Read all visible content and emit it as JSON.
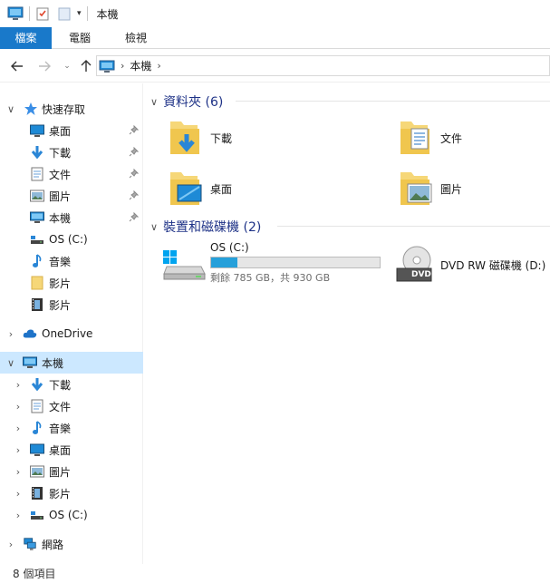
{
  "window": {
    "title": "本機"
  },
  "ribbon": {
    "tabs": [
      "檔案",
      "電腦",
      "檢視"
    ]
  },
  "address": {
    "crumb": "本機"
  },
  "sidebar": {
    "quick_access": {
      "label": "快速存取",
      "items": [
        "桌面",
        "下載",
        "文件",
        "圖片",
        "本機",
        "OS (C:)",
        "音樂",
        "影片",
        "影片"
      ]
    },
    "onedrive": "OneDrive",
    "this_pc": {
      "label": "本機",
      "items": [
        "下載",
        "文件",
        "音樂",
        "桌面",
        "圖片",
        "影片",
        "OS (C:)"
      ]
    },
    "network": "網路"
  },
  "content": {
    "folders_header": "資料夾 (6)",
    "folders": [
      "下載",
      "文件",
      "桌面",
      "圖片"
    ],
    "devices_header": "裝置和磁碟機 (2)",
    "drive_c": {
      "name": "OS (C:)",
      "free_text": "剩餘 785 GB，共 930 GB",
      "used_fraction": 0.156
    },
    "dvd": {
      "name": "DVD RW 磁碟機 (D:)",
      "badge": "DVD"
    }
  },
  "status": {
    "text": "8 個項目"
  },
  "colors": {
    "accent": "#1979ca",
    "selection": "#cce8ff",
    "bar_fill": "#26a0da",
    "header_text": "#1e3287"
  }
}
